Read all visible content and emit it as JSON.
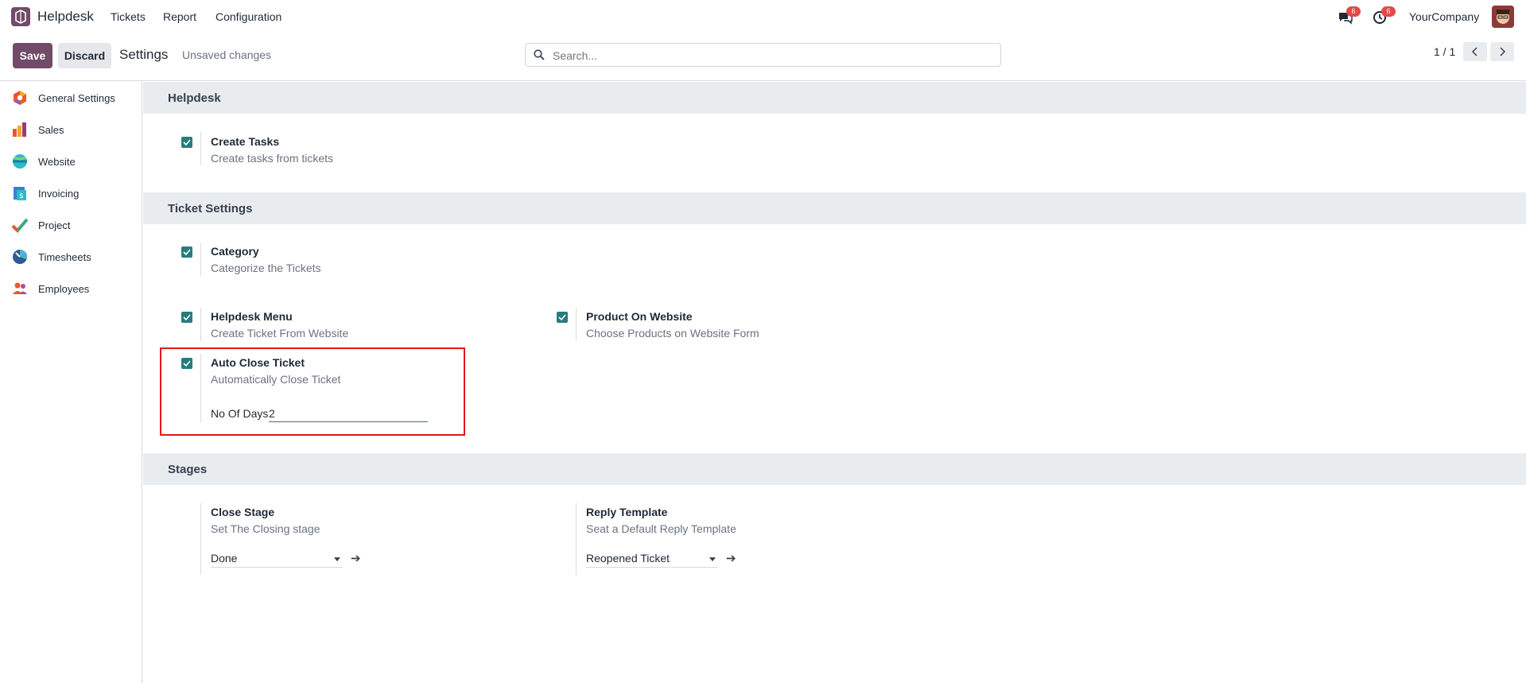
{
  "navbar": {
    "app_name": "Helpdesk",
    "menu": [
      "Tickets",
      "Report",
      "Configuration"
    ],
    "messages_badge": "6",
    "activities_badge": "6",
    "company": "YourCompany"
  },
  "controlbar": {
    "save_label": "Save",
    "discard_label": "Discard",
    "title": "Settings",
    "status": "Unsaved changes",
    "search_placeholder": "Search...",
    "pager": "1 / 1"
  },
  "sidebar": {
    "items": [
      {
        "label": "General Settings",
        "icon": "general-settings-icon",
        "color": "#e8582d"
      },
      {
        "label": "Sales",
        "icon": "sales-icon",
        "color": "#e8582d"
      },
      {
        "label": "Website",
        "icon": "website-icon",
        "color": "#2ebcc6"
      },
      {
        "label": "Invoicing",
        "icon": "invoicing-icon",
        "color": "#3b7fd8"
      },
      {
        "label": "Project",
        "icon": "project-icon",
        "color": "#3aa876"
      },
      {
        "label": "Timesheets",
        "icon": "timesheets-icon",
        "color": "#2a5d93"
      },
      {
        "label": "Employees",
        "icon": "employees-icon",
        "color": "#b34f8b"
      }
    ]
  },
  "sections": {
    "helpdesk": {
      "title": "Helpdesk",
      "create_tasks": {
        "title": "Create Tasks",
        "desc": "Create tasks from tickets",
        "checked": true
      }
    },
    "ticket_settings": {
      "title": "Ticket Settings",
      "category": {
        "title": "Category",
        "desc": "Categorize the Tickets",
        "checked": true
      },
      "helpdesk_menu": {
        "title": "Helpdesk Menu",
        "desc": "Create Ticket From Website",
        "checked": true
      },
      "product_on_website": {
        "title": "Product On Website",
        "desc": "Choose Products on Website Form",
        "checked": true
      },
      "auto_close": {
        "title": "Auto Close Ticket",
        "desc": "Automatically Close Ticket",
        "checked": true,
        "field_label": "No Of Days",
        "field_value": "2"
      }
    },
    "stages": {
      "title": "Stages",
      "close_stage": {
        "title": "Close Stage",
        "desc": "Set The Closing stage",
        "value": "Done"
      },
      "reply_template": {
        "title": "Reply Template",
        "desc": "Seat a Default Reply Template",
        "value": "Reopened Ticket"
      }
    }
  },
  "colors": {
    "brand": "#714b67",
    "accent": "#277d7d",
    "highlight": "#e3161f",
    "badge": "#e24a4a"
  }
}
